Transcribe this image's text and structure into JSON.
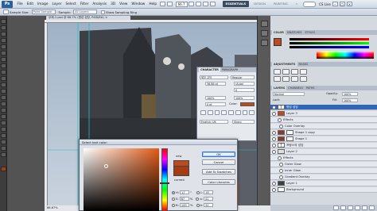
{
  "app": {
    "logo": "Ps"
  },
  "menu": [
    "File",
    "Edit",
    "Image",
    "Layer",
    "Select",
    "Filter",
    "Analysis",
    "3D",
    "View",
    "Window",
    "Help"
  ],
  "zoom": "66.7",
  "workspace": {
    "buttons": [
      "ESSENTIALS",
      "DESIGN",
      "PAINTING"
    ],
    "more": "»",
    "cslive": "CS Live"
  },
  "window_controls": [
    "–",
    "□",
    "×"
  ],
  "options": {
    "sample_size_label": "Sample Size:",
    "sample_size": "Point Sample",
    "sample_label": "Sample:",
    "sample": "All Layers",
    "show_ring": "Show Sampling Ring"
  },
  "document": {
    "tab": "무제-1.psd @ 66.7% (명성 성당, RGB/8#)",
    "status": "66.67%",
    "close": "×"
  },
  "character": {
    "tabs": [
      "CHARACTER",
      "PARAGRAPH"
    ],
    "font": "맑은 고딕",
    "style": "Regular",
    "size": "36.86 pt",
    "leading": "(Auto)",
    "tracking": "0",
    "scale_v": "100%",
    "scale_h": "100%",
    "baseline": "0 pt",
    "color_label": "Color:",
    "lang": "English: UK",
    "aa": "Sharp"
  },
  "color_picker": {
    "title": "Select text color:",
    "new_label": "new",
    "current_label": "current",
    "buttons": [
      "OK",
      "Cancel",
      "Add To Swatches",
      "Color Libraries"
    ],
    "fields": [
      {
        "label": "H:",
        "value": "17",
        "unit": "°",
        "label2": "L:",
        "value2": "45"
      },
      {
        "label": "S:",
        "value": "87",
        "unit": "%",
        "label2": "a:",
        "value2": "41"
      },
      {
        "label": "B:",
        "value": "100",
        "unit": "%",
        "label2": "b:",
        "value2": "52"
      }
    ],
    "new_color": "#c14a1c",
    "current_color": "#a53c12"
  },
  "color_panel": {
    "tabs": [
      "COLOR",
      "SWATCHES",
      "STYLES"
    ]
  },
  "adjustments": {
    "tabs": [
      "ADJUSTMENTS",
      "MASKS"
    ]
  },
  "layers": {
    "tabs": [
      "LAYERS",
      "CHANNELS",
      "PATHS"
    ],
    "blend": "Normal",
    "opacity_label": "Opacity:",
    "opacity": "100%",
    "fill_label": "Fill:",
    "fill": "100%",
    "lock_label": "Lock:",
    "rows": [
      {
        "name": "명성 성당",
        "kind": "text",
        "selected": true
      },
      {
        "name": "Layer 3",
        "kind": "layer"
      },
      {
        "name": "Effects",
        "kind": "fx"
      },
      {
        "name": "Color Overlay",
        "kind": "fx-item"
      },
      {
        "name": "Shape 1 copy",
        "kind": "shape"
      },
      {
        "name": "Shape 1",
        "kind": "shape"
      },
      {
        "name": "프랑스의 성당",
        "kind": "text"
      },
      {
        "name": "Layer 2",
        "kind": "layer"
      },
      {
        "name": "Effects",
        "kind": "fx"
      },
      {
        "name": "Outer Glow",
        "kind": "fx-item"
      },
      {
        "name": "Inner Glow",
        "kind": "fx-item"
      },
      {
        "name": "Gradient Overlay",
        "kind": "fx-item"
      },
      {
        "name": "Layer 1",
        "kind": "layer"
      },
      {
        "name": "Background",
        "kind": "bg"
      }
    ]
  }
}
